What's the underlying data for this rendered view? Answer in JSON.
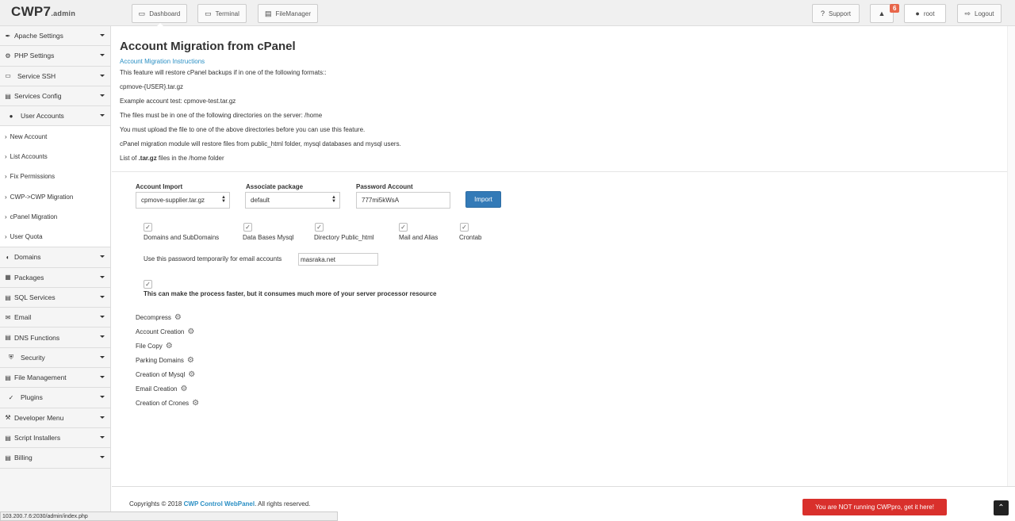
{
  "brand": {
    "name": "CWP7",
    "suffix": ".admin"
  },
  "topnav": {
    "dashboard": "Dashboard",
    "terminal": "Terminal",
    "filemanager": "FileManager",
    "support": "Support",
    "notifications_count": "6",
    "user": "root",
    "logout": "Logout"
  },
  "sidebar": {
    "items_top": [
      {
        "label": "Apache Settings",
        "icon": "feather-icon"
      },
      {
        "label": "PHP Settings",
        "icon": "gear-icon"
      },
      {
        "label": "Service SSH",
        "icon": "monitor-icon"
      },
      {
        "label": "Services Config",
        "icon": "server-icon"
      },
      {
        "label": "User Accounts",
        "icon": "user-icon"
      }
    ],
    "subitems": [
      "New Account",
      "List Accounts",
      "Fix Permissions",
      "CWP->CWP Migration",
      "cPanel Migration",
      "User Quota"
    ],
    "items_bottom": [
      {
        "label": "Domains",
        "icon": "globe-icon"
      },
      {
        "label": "Packages",
        "icon": "cubes-icon"
      },
      {
        "label": "SQL Services",
        "icon": "database-icon"
      },
      {
        "label": "Email",
        "icon": "envelope-icon"
      },
      {
        "label": "DNS Functions",
        "icon": "server-icon"
      },
      {
        "label": "Security",
        "icon": "shield-icon"
      },
      {
        "label": "File Management",
        "icon": "folder-icon"
      },
      {
        "label": "Plugins",
        "icon": "plug-icon"
      },
      {
        "label": "Developer Menu",
        "icon": "wrench-icon"
      },
      {
        "label": "Script Installers",
        "icon": "list-icon"
      },
      {
        "label": "Billing",
        "icon": "card-icon"
      }
    ]
  },
  "page": {
    "title": "Account Migration from cPanel",
    "instructions_link": "Account Migration Instructions",
    "lines": [
      "This feature will restore cPanel backups if in one of the following formats::",
      "cpmove-{USER}.tar.gz",
      "Example account test: cpmove-test.tar.gz",
      "The files must be in one of the following directories on the server: /home",
      "You must upload the file to one of the above directories before you can use this feature.",
      "cPanel migration module will restore files from public_html folder, mysql databases and mysql users."
    ],
    "list_prefix": "List of ",
    "list_bold": ".tar.gz",
    "list_suffix": " files in the /home folder"
  },
  "form": {
    "account_import_label": "Account Import",
    "account_import_value": "cpmove-supplier.tar.gz",
    "package_label": "Associate package",
    "package_value": "default",
    "password_label": "Password Account",
    "password_value": "777mi5kWsA",
    "import_button": "Import",
    "checkboxes": [
      "Domains and SubDomains",
      "Data Bases Mysql",
      "Directory Public_html",
      "Mail and Alias",
      "Crontab"
    ],
    "email_password_label": "Use this password temporarily for email accounts",
    "email_password_value": "masraka.net",
    "fast_note": "This can make the process faster, but it consumes much more of your server processor resource"
  },
  "steps": [
    "Decompress",
    "Account Creation",
    "File Copy",
    "Parking Domains",
    "Creation of Mysql",
    "Email Creation",
    "Creation of Crones"
  ],
  "footer": {
    "copyright_prefix": "Copyrights © 2018 ",
    "copyright_link": "CWP Control WebPanel",
    "copyright_suffix": ". All rights reserved.",
    "pro_button": "You are NOT running CWPpro, get it here!"
  },
  "statusbar": "103.200.7.6:2030/admin/index.php"
}
